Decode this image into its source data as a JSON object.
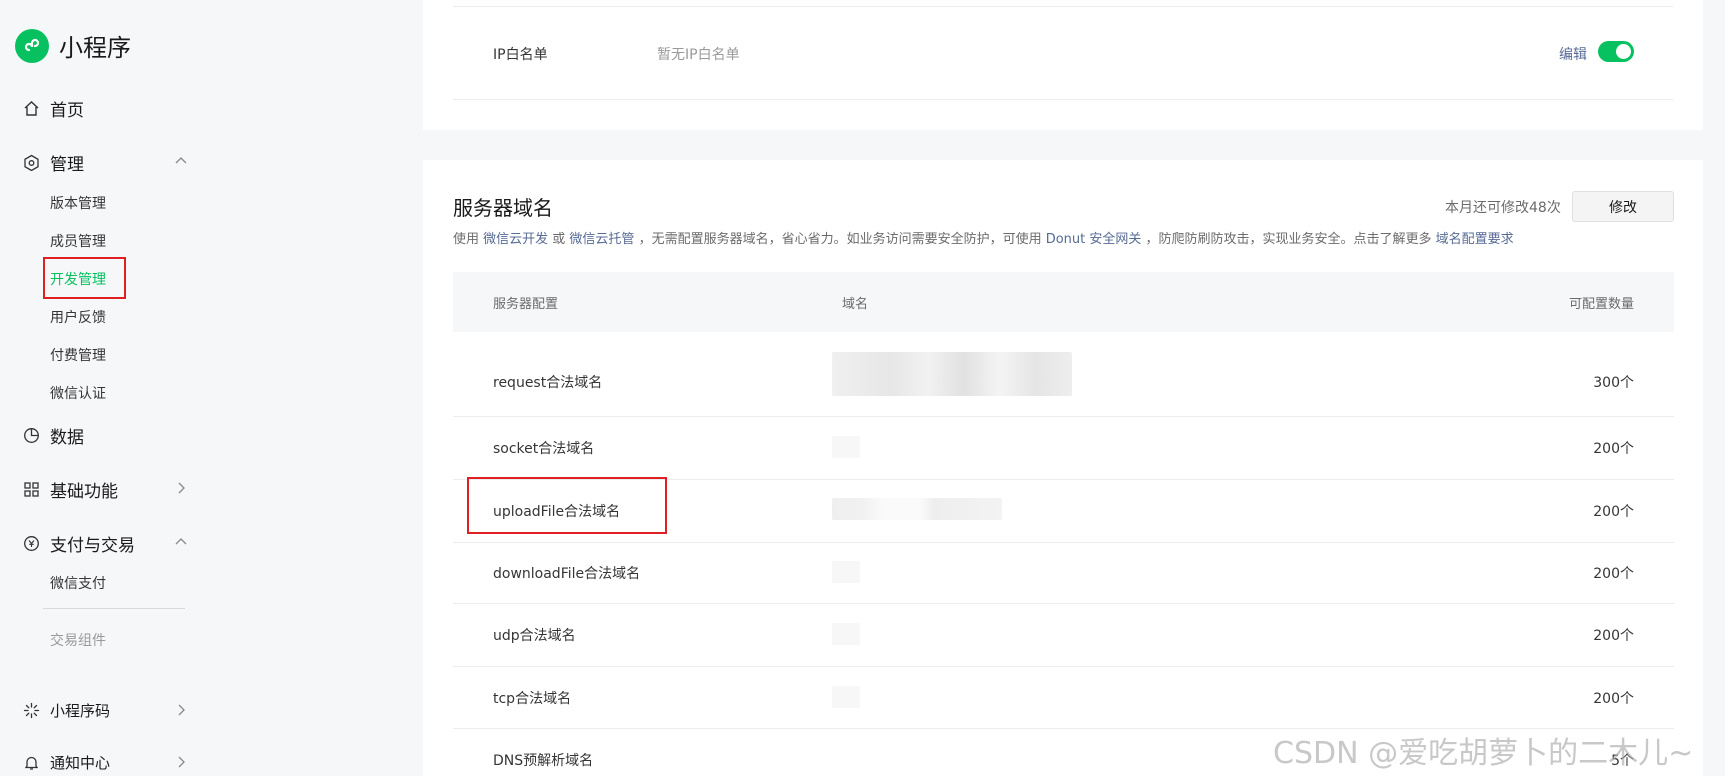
{
  "app": {
    "title": "小程序"
  },
  "sidebar": {
    "home": "首页",
    "manage": "管理",
    "manage_items": [
      "版本管理",
      "成员管理",
      "开发管理",
      "用户反馈",
      "付费管理",
      "微信认证"
    ],
    "data": "数据",
    "basic": "基础功能",
    "pay": "支付与交易",
    "pay_items": [
      "微信支付",
      "交易组件"
    ],
    "qrcode": "小程序码",
    "notify": "通知中心"
  },
  "ip_whitelist": {
    "label": "IP白名单",
    "value": "暂无IP白名单",
    "edit": "编辑",
    "toggle_on": true
  },
  "server_domain": {
    "title": "服务器域名",
    "remaining": "本月还可修改48次",
    "modify": "修改",
    "desc": {
      "t1": "使用 ",
      "link1": "微信云开发",
      "t2": " 或 ",
      "link2": "微信云托管",
      "t3": " ，无需配置服务器域名，省心省力。如业务访问需要安全防护，可使用 ",
      "link3": "Donut 安全网关",
      "t4": " ，防爬防刷防攻击，实现业务安全。点击了解更多 ",
      "link4": "域名配置要求"
    },
    "headers": [
      "服务器配置",
      "域名",
      "可配置数量"
    ],
    "rows": [
      {
        "name": "request合法域名",
        "count": "300个"
      },
      {
        "name": "socket合法域名",
        "count": "200个"
      },
      {
        "name": "uploadFile合法域名",
        "count": "200个"
      },
      {
        "name": "downloadFile合法域名",
        "count": "200个"
      },
      {
        "name": "udp合法域名",
        "count": "200个"
      },
      {
        "name": "tcp合法域名",
        "count": "200个"
      },
      {
        "name": "DNS预解析域名",
        "count": "5个"
      }
    ]
  },
  "watermark": "CSDN @爱吃胡萝卜的二木儿~",
  "colors": {
    "brand": "#07c160",
    "link": "#576b95",
    "highlight": "#e02020"
  }
}
